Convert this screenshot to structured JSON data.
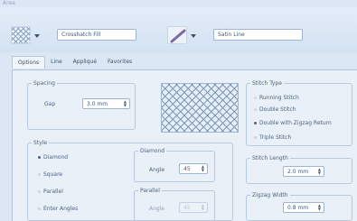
{
  "window": {
    "title": "Area"
  },
  "toolbar": {
    "fill_name": "Crosshatch Fill",
    "line_name": "Satin Line"
  },
  "tabs": [
    {
      "label": "Options"
    },
    {
      "label": "Line"
    },
    {
      "label": "Appliqué"
    },
    {
      "label": "Favorites"
    }
  ],
  "spacing": {
    "group_label": "Spacing",
    "gap_label": "Gap",
    "gap_value": "3.0 mm"
  },
  "style": {
    "group_label": "Style",
    "options": [
      {
        "label": "Diamond",
        "selected": true
      },
      {
        "label": "Square",
        "selected": false
      },
      {
        "label": "Parallel",
        "selected": false
      },
      {
        "label": "Enter Angles",
        "selected": false
      }
    ]
  },
  "diamond": {
    "group_label": "Diamond",
    "angle_label": "Angle",
    "angle_value": "45"
  },
  "parallel": {
    "group_label": "Parallel",
    "angle_label": "Angle",
    "angle_value": "45"
  },
  "stitch_type": {
    "group_label": "Stitch Type",
    "options": [
      {
        "label": "Running Stitch",
        "selected": false
      },
      {
        "label": "Double Stitch",
        "selected": false
      },
      {
        "label": "Double with Zigzag Return",
        "selected": true
      },
      {
        "label": "Triple Stitch",
        "selected": false
      }
    ]
  },
  "stitch_length": {
    "group_label": "Stitch Length",
    "value": "2.0 mm"
  },
  "zigzag_width": {
    "group_label": "Zigzag Width",
    "value": "0.8 mm"
  },
  "colors": {
    "background": "#dbe7f4",
    "panel": "#e9f0f8",
    "text": "#2b3f58"
  }
}
